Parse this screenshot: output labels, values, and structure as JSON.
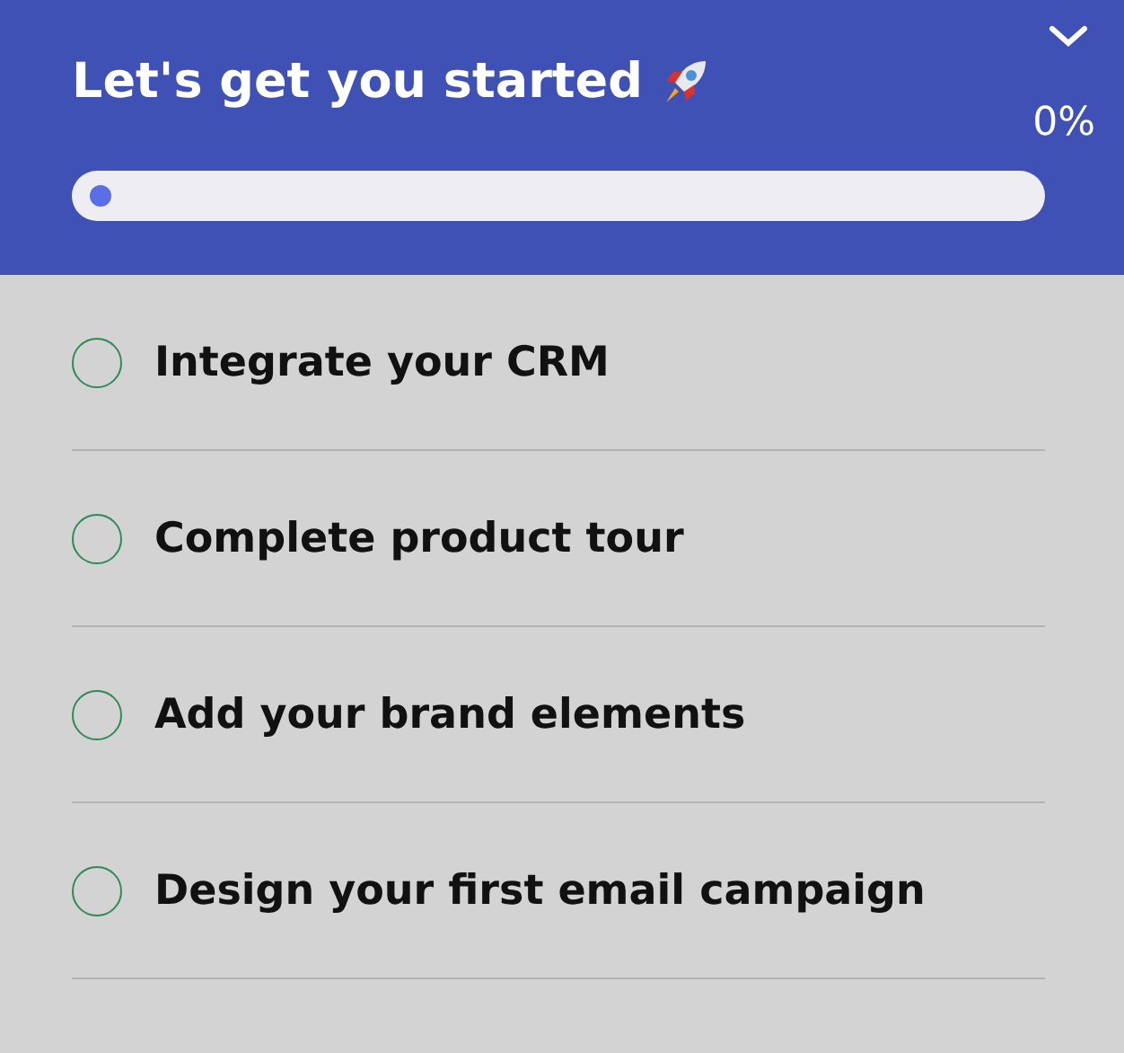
{
  "header": {
    "title": "Let's get you started",
    "expanded": true,
    "percent": "0%",
    "progress": {
      "level": 0
    }
  },
  "tasks": [
    {
      "label": "Integrate your CRM",
      "checked": false
    },
    {
      "label": "Complete product tour",
      "checked": false
    },
    {
      "label": "Add your brand elements",
      "checked": false
    },
    {
      "label": "Design your first email campaign",
      "checked": false
    }
  ]
}
